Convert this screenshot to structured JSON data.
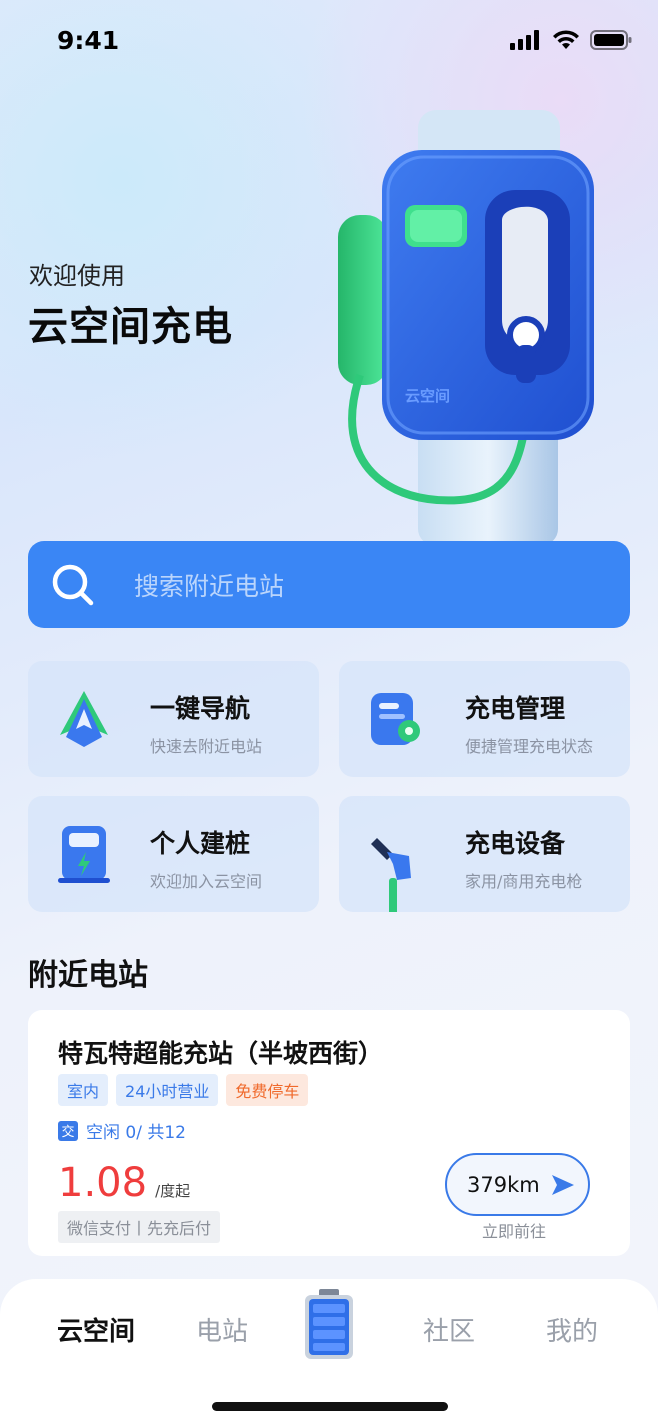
{
  "status_bar": {
    "time": "9:41"
  },
  "hero": {
    "welcome_sub": "欢迎使用",
    "welcome_title": "云空间充电",
    "charger_brand": "云空间"
  },
  "search": {
    "placeholder": "搜索附近电站",
    "icon": "search-icon"
  },
  "quick_actions": [
    {
      "title": "一键导航",
      "subtitle": "快速去附近电站",
      "icon": "navigation-icon"
    },
    {
      "title": "充电管理",
      "subtitle": "便捷管理充电状态",
      "icon": "management-icon"
    },
    {
      "title": "个人建桩",
      "subtitle": "欢迎加入云空间",
      "icon": "charging-pile-icon"
    },
    {
      "title": "充电设备",
      "subtitle": "家用/商用充电枪",
      "icon": "charging-gun-icon"
    }
  ],
  "nearby": {
    "section_title": "附近电站",
    "station": {
      "name": "特瓦特超能充站（半坡西街）",
      "tags": [
        "室内",
        "24小时营业",
        "免费停车"
      ],
      "ac_badge": "交",
      "availability": "空闲 0/ 共12",
      "price": "1.08",
      "price_unit": "/度起",
      "payment": "微信支付丨先充后付",
      "distance": "379km",
      "go_label": "立即前往"
    }
  },
  "tabbar": {
    "tabs": [
      "云空间",
      "电站",
      "社区",
      "我的"
    ],
    "active": "云空间",
    "center_icon": "battery-icon"
  },
  "colors": {
    "primary": "#3a86f5",
    "price_red": "#ef3d3d",
    "tag_orange": "#f06a2c",
    "accent_green": "#2fc97a"
  }
}
